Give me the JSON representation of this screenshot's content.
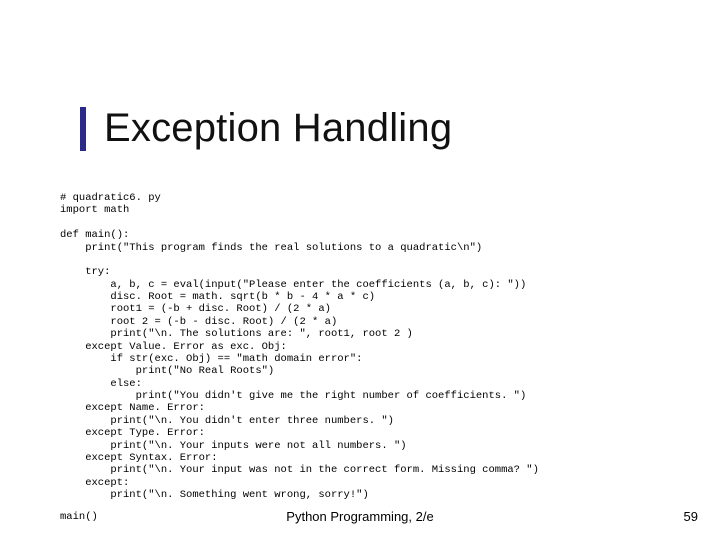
{
  "title": "Exception Handling",
  "code": "# quadratic6. py\nimport math\n\ndef main():\n    print(\"This program finds the real solutions to a quadratic\\n\")\n\n    try:\n        a, b, c = eval(input(\"Please enter the coefficients (a, b, c): \"))\n        disc. Root = math. sqrt(b * b - 4 * a * c)\n        root1 = (-b + disc. Root) / (2 * a)\n        root 2 = (-b - disc. Root) / (2 * a)\n        print(\"\\n. The solutions are: \", root1, root 2 )\n    except Value. Error as exc. Obj:\n        if str(exc. Obj) == \"math domain error\":\n            print(\"No Real Roots\")\n        else:\n            print(\"You didn't give me the right number of coefficients. \")\n    except Name. Error:\n        print(\"\\n. You didn't enter three numbers. \")\n    except Type. Error:\n        print(\"\\n. Your inputs were not all numbers. \")\n    except Syntax. Error:\n        print(\"\\n. Your input was not in the correct form. Missing comma? \")\n    except:\n        print(\"\\n. Something went wrong, sorry!\")",
  "footer": {
    "left": "main()",
    "center": "Python Programming, 2/e",
    "page": "59"
  }
}
